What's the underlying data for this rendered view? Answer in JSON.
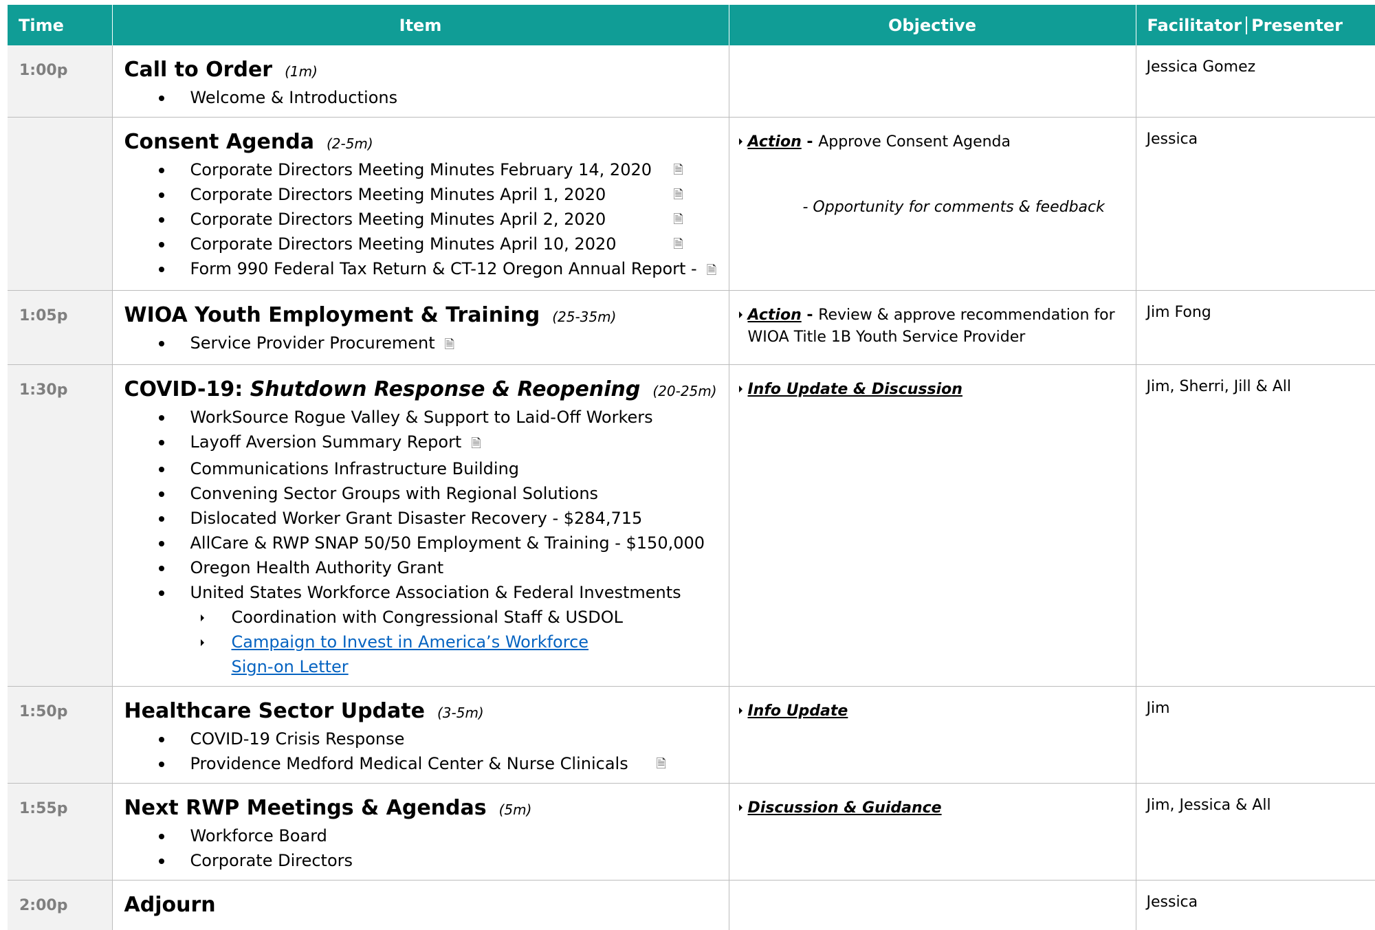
{
  "headers": {
    "time": "Time",
    "item": "Item",
    "objective": "Objective",
    "facilitator": "Facilitator",
    "presenter": "Presenter"
  },
  "rows": [
    {
      "time": "1:00p",
      "title": "Call to Order",
      "duration": "(1m)",
      "bullets": [
        "Welcome & Introductions"
      ],
      "facilitator": "Jessica Gomez"
    },
    {
      "time": "",
      "title": "Consent Agenda",
      "duration": "(2-5m)",
      "bullets": [
        "Corporate Directors Meeting Minutes  February 14, 2020",
        "Corporate Directors Meeting Minutes April 1, 2020",
        "Corporate Directors Meeting Minutes  April 2, 2020",
        "Corporate Directors Meeting Minutes  April 10, 2020",
        "Form 990 Federal Tax Return & CT-12 Oregon Annual Report -"
      ],
      "objective_action": "Action",
      "objective_sep": " - ",
      "objective_text": "Approve Consent Agenda",
      "objective_note": "-  Opportunity for comments & feedback",
      "facilitator": "Jessica"
    },
    {
      "time": "1:05p",
      "title": "WIOA Youth Employment & Training",
      "duration": "(25-35m)",
      "bullets": [
        "Service Provider Procurement"
      ],
      "objective_action": "Action",
      "objective_sep": " - ",
      "objective_text": "Review & approve recommendation for",
      "objective_text2": "WIOA Title 1B Youth Service Provider",
      "facilitator": "Jim Fong"
    },
    {
      "time": "1:30p",
      "title_a": "COVID-19:",
      "title_b": "Shutdown Response & Reopening",
      "duration": "(20-25m)",
      "bullets": [
        "WorkSource Rogue Valley & Support to Laid-Off Workers",
        "Layoff Aversion Summary Report",
        "Communications Infrastructure Building",
        "Convening Sector Groups with Regional Solutions",
        "Dislocated Worker Grant Disaster Recovery  -  $284,715",
        "AllCare & RWP SNAP 50/50 Employment & Training  -  $150,000",
        "Oregon Health Authority Grant",
        "United States Workforce Association & Federal Investments"
      ],
      "sub_bullets": [
        "Coordination with Congressional Staff & USDOL"
      ],
      "link_line1": "Campaign to Invest in America’s Workforce",
      "link_line2": "Sign-on Letter",
      "objective_action": "Info Update & Discussion",
      "facilitator": "Jim, Sherri, Jill & All"
    },
    {
      "time": "1:50p",
      "title": "Healthcare Sector Update",
      "duration": "(3-5m)",
      "bullets": [
        "COVID-19 Crisis Response",
        "Providence Medford Medical Center & Nurse Clinicals"
      ],
      "objective_action": "Info Update",
      "facilitator": "Jim"
    },
    {
      "time": "1:55p",
      "title": "Next RWP Meetings & Agendas",
      "duration": "(5m)",
      "bullets": [
        "Workforce Board",
        "Corporate Directors"
      ],
      "objective_action": "Discussion & Guidance",
      "facilitator": "Jim, Jessica & All"
    },
    {
      "time": "2:00p",
      "title": "Adjourn",
      "facilitator": "Jessica"
    }
  ],
  "icons": {
    "document": "document-icon"
  },
  "colors": {
    "header_bg": "#109d96",
    "time_bg": "#f2f2f2",
    "time_text": "#7f7f7f",
    "link": "#0563c1"
  }
}
